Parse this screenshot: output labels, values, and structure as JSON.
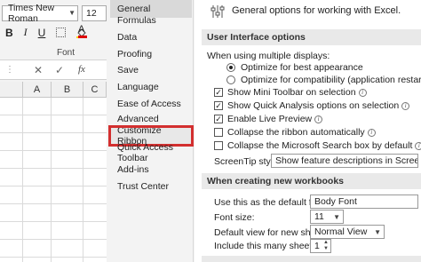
{
  "excel": {
    "font_name": "Times New Roman",
    "font_size": "12",
    "format_buttons": [
      "B",
      "I",
      "U"
    ],
    "fill_letter": "A",
    "font_group_label": "Font",
    "formula_bar": {
      "cancel": "✕",
      "enter": "✓",
      "fx": "fx"
    },
    "columns": [
      "A",
      "B",
      "C"
    ]
  },
  "sidebar": {
    "items": [
      {
        "label": "General",
        "selected": true
      },
      {
        "label": "Formulas"
      },
      {
        "label": "Data"
      },
      {
        "label": "Proofing"
      },
      {
        "label": "Save"
      },
      {
        "label": "Language"
      },
      {
        "label": "Ease of Access"
      },
      {
        "label": "Advanced"
      },
      {
        "label": "Customize Ribbon",
        "highlighted": true
      },
      {
        "label": "Quick Access Toolbar"
      },
      {
        "label": "Add-ins"
      },
      {
        "label": "Trust Center"
      }
    ]
  },
  "main": {
    "header": "General options for working with Excel.",
    "ui_section": "User Interface options",
    "multi_display_label": "When using multiple displays:",
    "radio_best": "Optimize for best appearance",
    "radio_compat": "Optimize for compatibility (application restart required)",
    "chk_mini_toolbar": "Show Mini Toolbar on selection",
    "chk_quick_analysis": "Show Quick Analysis options on selection",
    "chk_live_preview": "Enable Live Preview",
    "chk_collapse_ribbon": "Collapse the ribbon automatically",
    "chk_collapse_search": "Collapse the Microsoft Search box by default",
    "screentip_label": "ScreenTip style:",
    "screentip_value": "Show feature descriptions in ScreenTips",
    "new_wb_section": "When creating new workbooks",
    "default_font_label": "Use this as the default font:",
    "default_font_value": "Body Font",
    "font_size_label": "Font size:",
    "font_size_value": "11",
    "default_view_label": "Default view for new sheets:",
    "default_view_value": "Normal View",
    "sheets_label": "Include this many sheets:",
    "sheets_value": "1"
  }
}
